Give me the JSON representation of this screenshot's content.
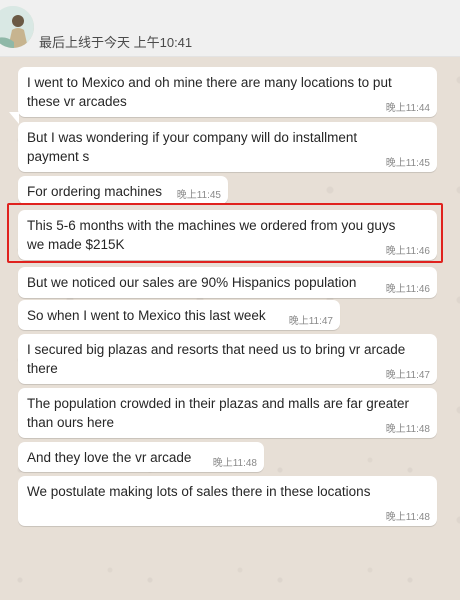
{
  "header": {
    "last_seen": "最后上线于今天 上午10:41"
  },
  "messages": [
    {
      "text": "I went to Mexico and oh mine there are many locations to put\nthese vr arcades",
      "time": "晚上11:44"
    },
    {
      "text": "But I was wondering if your company will do installment\npayment s",
      "time": "晚上11:45"
    },
    {
      "text": "For ordering machines",
      "time": "晚上11:45"
    },
    {
      "text": "This 5-6 months with the machines we ordered from you guys\nwe made $215K",
      "time": "晚上11:46"
    },
    {
      "text": "But we noticed our sales are 90% Hispanics population",
      "time": "晚上11:46"
    },
    {
      "text": "So when I went to Mexico this last week",
      "time": "晚上11:47"
    },
    {
      "text": "I secured big plazas and resorts that need us to bring vr arcade\nthere",
      "time": "晚上11:47"
    },
    {
      "text": "The population crowded in their plazas and malls are far greater\nthan ours here",
      "time": "晚上11:48"
    },
    {
      "text": "And they love the vr arcade",
      "time": "晚上11:48"
    },
    {
      "text": "We postulate making lots of sales there in these locations",
      "time": "晚上11:48"
    }
  ]
}
